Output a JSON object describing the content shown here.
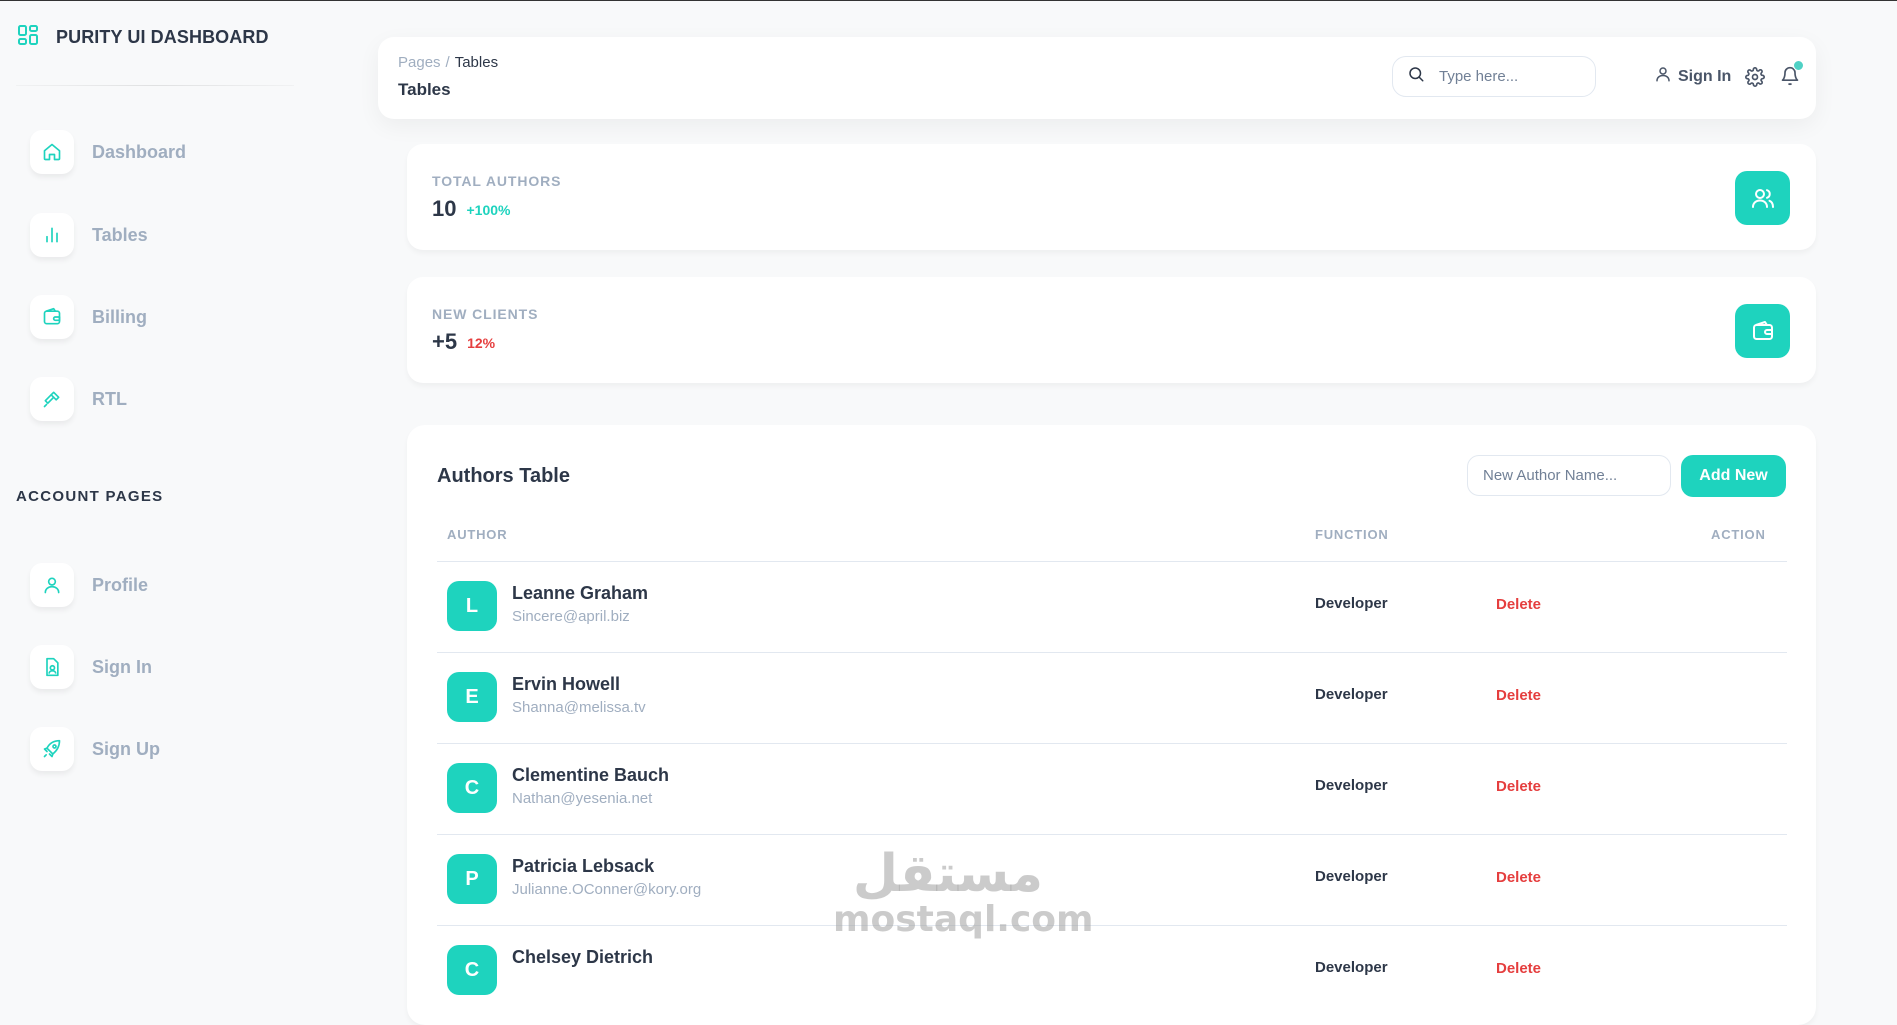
{
  "brand": {
    "title": "PURITY UI DASHBOARD"
  },
  "sidebar": {
    "items": [
      {
        "label": "Dashboard",
        "icon": "home-icon"
      },
      {
        "label": "Tables",
        "icon": "bar-chart-icon"
      },
      {
        "label": "Billing",
        "icon": "wallet-icon"
      },
      {
        "label": "RTL",
        "icon": "build-icon"
      }
    ],
    "account_title": "ACCOUNT PAGES",
    "account_items": [
      {
        "label": "Profile",
        "icon": "user-icon"
      },
      {
        "label": "Sign In",
        "icon": "document-icon"
      },
      {
        "label": "Sign Up",
        "icon": "rocket-icon"
      }
    ]
  },
  "header": {
    "breadcrumb_root": "Pages",
    "breadcrumb_sep": "/",
    "breadcrumb_current": "Tables",
    "title": "Tables",
    "search_placeholder": "Type here...",
    "signin_label": "Sign In"
  },
  "stats": [
    {
      "label": "TOTAL AUTHORS",
      "value": "10",
      "change": "+100%",
      "change_color": "#1ed3be",
      "icon": "users-icon"
    },
    {
      "label": "NEW CLIENTS",
      "value": "+5",
      "change": "12%",
      "change_color": "#e53e3e",
      "icon": "wallet-icon"
    }
  ],
  "authors_table": {
    "title": "Authors Table",
    "input_placeholder": "New Author Name...",
    "add_button": "Add New",
    "columns": {
      "author": "AUTHOR",
      "function": "FUNCTION",
      "action": "ACTION"
    },
    "rows": [
      {
        "initial": "L",
        "name": "Leanne Graham",
        "email": "Sincere@april.biz",
        "function": "Developer",
        "action": "Delete"
      },
      {
        "initial": "E",
        "name": "Ervin Howell",
        "email": "Shanna@melissa.tv",
        "function": "Developer",
        "action": "Delete"
      },
      {
        "initial": "C",
        "name": "Clementine Bauch",
        "email": "Nathan@yesenia.net",
        "function": "Developer",
        "action": "Delete"
      },
      {
        "initial": "P",
        "name": "Patricia Lebsack",
        "email": "Julianne.OConner@kory.org",
        "function": "Developer",
        "action": "Delete"
      },
      {
        "initial": "C",
        "name": "Chelsey Dietrich",
        "email": "",
        "function": "Developer",
        "action": "Delete"
      }
    ]
  },
  "watermark": {
    "arabic": "مستقل",
    "latin": "mostaql.com"
  },
  "colors": {
    "accent": "#1ed3be",
    "danger": "#e53e3e",
    "muted": "#a0aec0",
    "text": "#2d3748"
  }
}
